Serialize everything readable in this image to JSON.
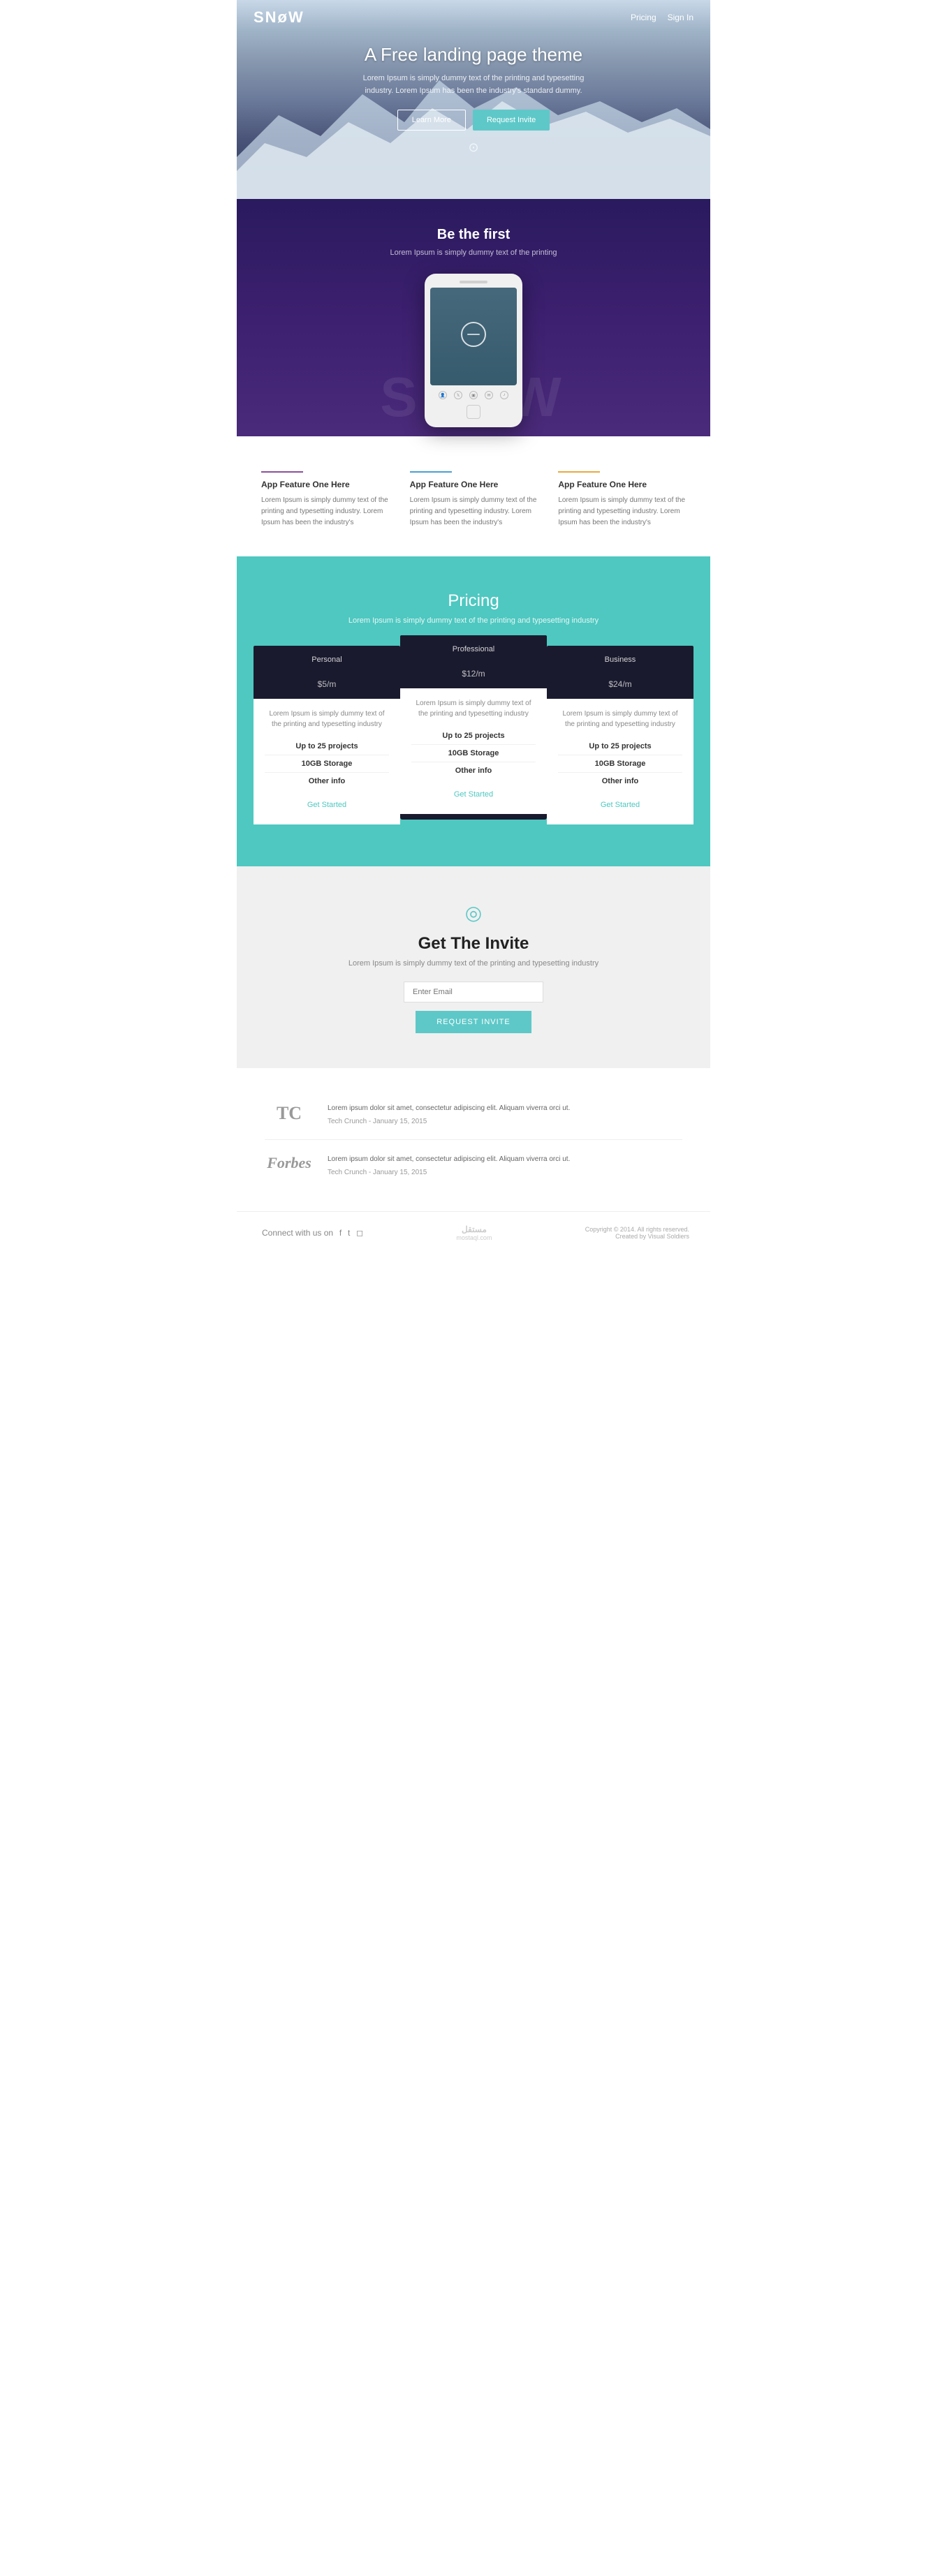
{
  "navbar": {
    "logo": "SNøW",
    "links": [
      "Pricing",
      "Sign In"
    ]
  },
  "hero": {
    "title": "A Free landing page theme",
    "description": "Lorem Ipsum is simply dummy text of the printing and typesetting industry. Lorem Ipsum has been the industry's standard dummy.",
    "btn_learn": "Learn More",
    "btn_invite": "Request Invite"
  },
  "be_first": {
    "title": "Be the first",
    "description": "Lorem Ipsum is simply dummy text of the printing",
    "watermark": "SNøW"
  },
  "features": [
    {
      "color": "purple",
      "title": "App Feature One Here",
      "description": "Lorem Ipsum is simply dummy text of the printing and typesetting industry. Lorem Ipsum has been the industry's"
    },
    {
      "color": "blue",
      "title": "App Feature One Here",
      "description": "Lorem Ipsum is simply dummy text of the printing and typesetting industry. Lorem Ipsum has been the industry's"
    },
    {
      "color": "orange",
      "title": "App Feature One Here",
      "description": "Lorem Ipsum is simply dummy text of the printing and typesetting industry. Lorem Ipsum has been the industry's"
    }
  ],
  "pricing": {
    "title": "Pricing",
    "subtitle": "Lorem Ipsum is simply dummy text of the printing and typesetting industry",
    "cards": [
      {
        "id": "personal",
        "label": "Personal",
        "price": "$5",
        "period": "/m",
        "featured": false,
        "description": "Lorem Ipsum is simply dummy text of the printing and typesetting industry",
        "features": [
          "Up to 25 projects",
          "10GB Storage",
          "Other info"
        ],
        "cta": "Get Started"
      },
      {
        "id": "professional",
        "label": "Professional",
        "price": "$12",
        "period": "/m",
        "featured": true,
        "description": "Lorem Ipsum is simply dummy text of the printing and typesetting industry",
        "features": [
          "Up to 25 projects",
          "10GB Storage",
          "Other info"
        ],
        "cta": "Get Started"
      },
      {
        "id": "business",
        "label": "Business",
        "price": "$24",
        "period": "/m",
        "featured": false,
        "description": "Lorem Ipsum is simply dummy text of the printing and typesetting industry",
        "features": [
          "Up to 25 projects",
          "10GB Storage",
          "Other info"
        ],
        "cta": "Get Started"
      }
    ]
  },
  "get_invite": {
    "title": "Get The Invite",
    "description": "Lorem Ipsum is simply dummy text of the printing and typesetting industry",
    "input_placeholder": "Enter Email",
    "btn_label": "REQUEST INVITE"
  },
  "press": [
    {
      "logo_type": "tc",
      "logo_text": "TC",
      "text": "Lorem ipsum dolor sit amet, consectetur adipiscing elit. Aliquam viverra orci ut.",
      "date": "Tech Crunch - January 15, 2015"
    },
    {
      "logo_type": "forbes",
      "logo_text": "Forbes",
      "text": "Lorem ipsum dolor sit amet, consectetur adipiscing elit. Aliquam viverra orci ut.",
      "date": "Tech Crunch - January 15, 2015"
    }
  ],
  "footer": {
    "connect_text": "Connect with us on",
    "watermark": "مستقل\nmostaql.com",
    "copyright": "Copyright © 2014. All rights reserved.",
    "created": "Created by Visual Soldiers"
  }
}
